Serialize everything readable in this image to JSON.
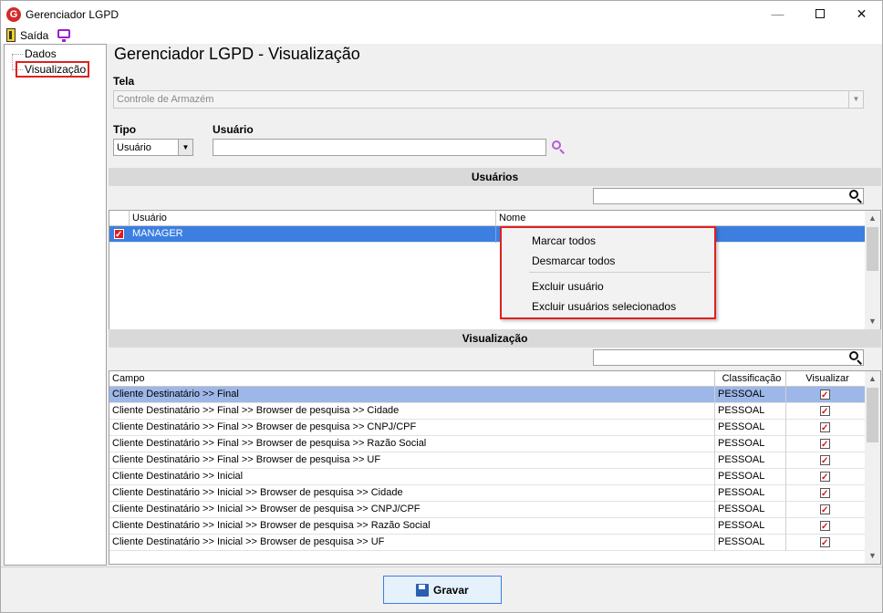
{
  "window": {
    "title": "Gerenciador LGPD",
    "logo_letter": "G",
    "controls": {
      "minimize": "—",
      "close": "✕"
    }
  },
  "toolbar": {
    "exit_label": "Saída"
  },
  "tree": {
    "items": [
      "Dados",
      "Visualização"
    ],
    "selected": "Visualização"
  },
  "page": {
    "title": "Gerenciador LGPD - Visualização"
  },
  "tela": {
    "label": "Tela",
    "value": "Controle de Armazém"
  },
  "tipo": {
    "label": "Tipo",
    "value": "Usuário"
  },
  "usuario": {
    "label": "Usuário",
    "value": ""
  },
  "users_section": {
    "title": "Usuários",
    "search_value": "",
    "columns": [
      "Usuário",
      "Nome"
    ],
    "rows": [
      {
        "checked": true,
        "usuario": "MANAGER",
        "nome": ""
      }
    ]
  },
  "context_menu": {
    "items": [
      "Marcar todos",
      "Desmarcar todos",
      "Excluir usuário",
      "Excluir usuários selecionados"
    ]
  },
  "view_section": {
    "title": "Visualização",
    "search_value": "",
    "columns": [
      "Campo",
      "Classificação",
      "Visualizar"
    ],
    "rows": [
      {
        "campo": "Cliente Destinatário >> Final",
        "classificacao": "PESSOAL",
        "visualizar": true
      },
      {
        "campo": "Cliente Destinatário >> Final >> Browser de pesquisa >> Cidade",
        "classificacao": "PESSOAL",
        "visualizar": true
      },
      {
        "campo": "Cliente Destinatário >> Final >> Browser de pesquisa >> CNPJ/CPF",
        "classificacao": "PESSOAL",
        "visualizar": true
      },
      {
        "campo": "Cliente Destinatário >> Final >> Browser de pesquisa >> Razão Social",
        "classificacao": "PESSOAL",
        "visualizar": true
      },
      {
        "campo": "Cliente Destinatário >> Final >> Browser de pesquisa >> UF",
        "classificacao": "PESSOAL",
        "visualizar": true
      },
      {
        "campo": "Cliente Destinatário >> Inicial",
        "classificacao": "PESSOAL",
        "visualizar": true
      },
      {
        "campo": "Cliente Destinatário >> Inicial >> Browser de pesquisa >> Cidade",
        "classificacao": "PESSOAL",
        "visualizar": true
      },
      {
        "campo": "Cliente Destinatário >> Inicial >> Browser de pesquisa >> CNPJ/CPF",
        "classificacao": "PESSOAL",
        "visualizar": true
      },
      {
        "campo": "Cliente Destinatário >> Inicial >> Browser de pesquisa >> Razão Social",
        "classificacao": "PESSOAL",
        "visualizar": true
      },
      {
        "campo": "Cliente Destinatário >> Inicial >> Browser de pesquisa >> UF",
        "classificacao": "PESSOAL",
        "visualizar": true
      }
    ]
  },
  "buttons": {
    "save_label": "Gravar"
  },
  "colors": {
    "selection": "#3c7fe0",
    "highlight": "#9db8e8",
    "accent_red": "#e02020",
    "search_icon": "#b45cd6"
  }
}
